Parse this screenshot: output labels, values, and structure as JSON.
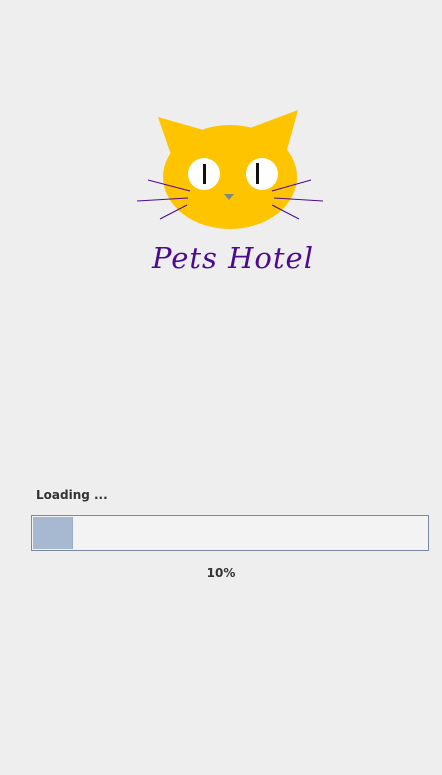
{
  "splash": {
    "logo": {
      "icon": "cat-face-icon",
      "brand_text": "Pets Hotel",
      "colors": {
        "cat_face": "#ffc400",
        "whiskers": "#4b0a91",
        "brand_text": "#4b0a91"
      }
    },
    "loading": {
      "label": "Loading ...",
      "progress_fraction": 0.1,
      "progress_text": "10%",
      "colors": {
        "bar_fill": "#a7b9d0",
        "bar_border": "#7a8aa6"
      }
    }
  }
}
